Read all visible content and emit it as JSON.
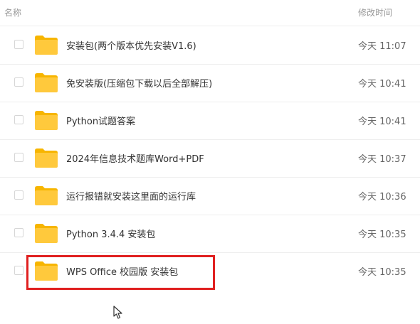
{
  "header": {
    "name_label": "名称",
    "time_label": "修改时间"
  },
  "colors": {
    "folder_body": "#FFC93C",
    "folder_tab": "#F7B500",
    "highlight_border": "#E02020",
    "divider": "#EEEEEE"
  },
  "files": [
    {
      "name": "安装包(两个版本优先安装V1.6)",
      "time": "今天 11:07",
      "icon": "folder-icon"
    },
    {
      "name": "免安装版(压缩包下载以后全部解压)",
      "time": "今天 10:41",
      "icon": "folder-icon"
    },
    {
      "name": "Python试题答案",
      "time": "今天 10:41",
      "icon": "folder-icon"
    },
    {
      "name": "2024年信息技术题库Word+PDF",
      "time": "今天 10:37",
      "icon": "folder-icon"
    },
    {
      "name": "运行报错就安装这里面的运行库",
      "time": "今天 10:36",
      "icon": "folder-icon"
    },
    {
      "name": "Python 3.4.4 安装包",
      "time": "今天 10:35",
      "icon": "folder-icon"
    },
    {
      "name": "WPS Office 校园版 安装包",
      "time": "今天 10:35",
      "icon": "folder-icon"
    }
  ],
  "highlighted_row": "WPS Office 校园版 安装包",
  "cursor_icon": "mouse-pointer-icon"
}
